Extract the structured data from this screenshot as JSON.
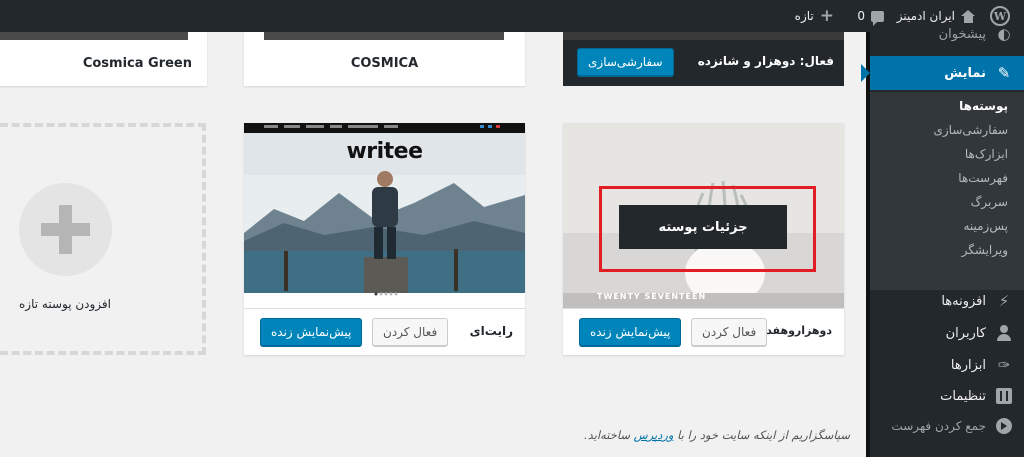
{
  "adminbar": {
    "site_name": "ایران ادمینز",
    "comments_count": "0",
    "new_label": "تازه"
  },
  "sidebar": {
    "cut_item": "پیشخوان",
    "appearance": "نمایش",
    "submenu": [
      "پوسته‌ها",
      "سفارشی‌سازی",
      "ابزارک‌ها",
      "فهرست‌ها",
      "سربرگ",
      "پس‌زمینه",
      "ویرایشگر"
    ],
    "plugins": "افزونه‌ها",
    "users": "کاربران",
    "tools": "ابزارها",
    "settings": "تنظیمات",
    "collapse": "جمع کردن فهرست"
  },
  "themes": {
    "active": {
      "label": "فعال: دوهزار و شانزده",
      "customize": "سفارشی‌سازی"
    },
    "cosmica": {
      "name": "COSMICA"
    },
    "cosmica_green": {
      "name": "Cosmica Green"
    },
    "twenty_seventeen": {
      "name": "دوهزاروهفده",
      "screenshot_text": "TWENTY SEVENTEEN",
      "details": "جزئیات پوسته",
      "activate": "فعال کردن",
      "preview": "پیش‌نمایش زنده"
    },
    "writee": {
      "name": "رایت‌ای",
      "logo": "writee",
      "activate": "فعال کردن",
      "preview": "پیش‌نمایش زنده"
    },
    "add_new": {
      "label": "افزودن پوسته تازه"
    }
  },
  "footer": {
    "before": "سپاسگزاریم از اینکه سایت خود را با ",
    "link": "وردپرس",
    "after": " ساخته‌اید."
  },
  "colors": {
    "primary": "#0085ba",
    "adminbar": "#23282d",
    "highlight": "#e21d24"
  }
}
